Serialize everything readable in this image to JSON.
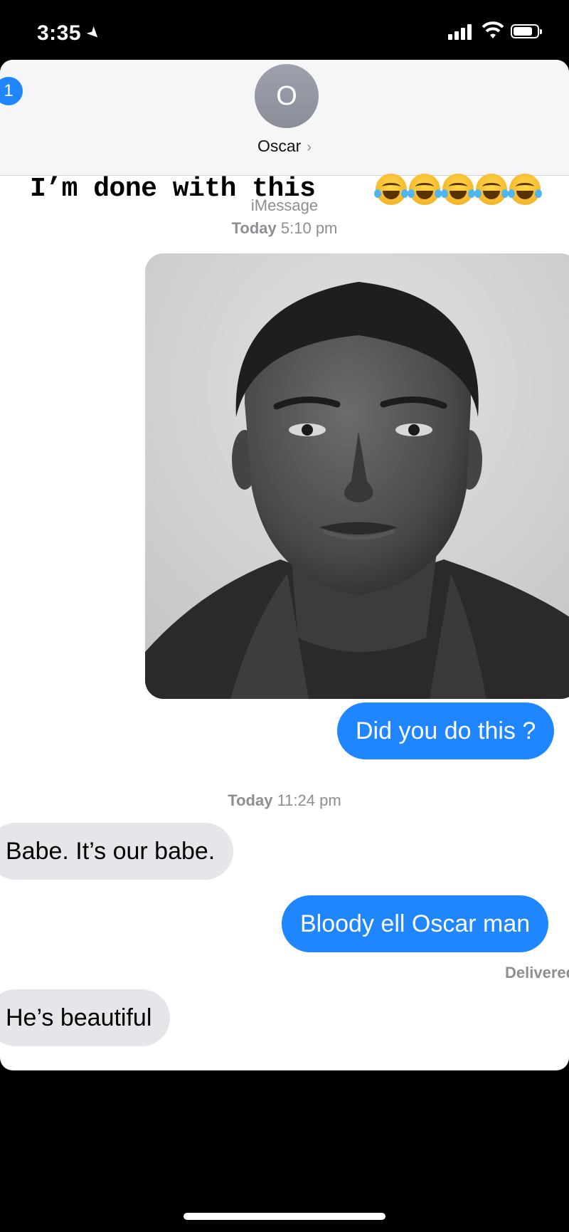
{
  "status_bar": {
    "time": "3:35",
    "location_arrow": "location-arrow-icon",
    "signal": "cellular-signal-icon",
    "wifi": "wifi-icon",
    "battery": "battery-icon"
  },
  "nav": {
    "back_badge_count": "1",
    "contact_initial": "O",
    "contact_name": "Oscar",
    "chevron": "›"
  },
  "caption": {
    "text": "I’m done with this",
    "emoji": "face-with-tears-of-joy-icon",
    "emoji_count": 5
  },
  "conversation": {
    "service_label": "iMessage",
    "timestamps": [
      {
        "day": "Today",
        "time": "5:10 pm"
      },
      {
        "day": "Today",
        "time": "11:24 pm"
      }
    ],
    "photo": {
      "description_icon": "portrait-photo"
    },
    "messages": [
      {
        "side": "sent",
        "text": "Did you do this ?"
      },
      {
        "side": "received",
        "text": "Babe. It’s our babe."
      },
      {
        "side": "sent",
        "text": "Bloody ell Oscar man"
      },
      {
        "side": "received",
        "text": "He’s beautiful"
      }
    ],
    "delivered_label": "Delivered"
  },
  "colors": {
    "sent_bubble": "#1f86ff",
    "received_bubble": "#e5e5ea",
    "badge": "#1f86ff"
  }
}
